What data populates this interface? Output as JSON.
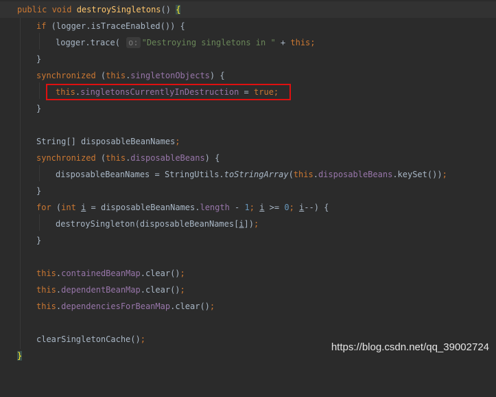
{
  "code": {
    "l1": {
      "mod": "public void ",
      "method": "destroySingletons",
      "rest": "() ",
      "brace": "{"
    },
    "l2": {
      "kw": "if",
      "rest": " (logger.isTraceEnabled()) {"
    },
    "l3": {
      "pre": "logger.trace( ",
      "hint": "o:",
      "str": "\"Destroying singletons in \"",
      "mid": " + ",
      "kw": "this",
      "semi": ";"
    },
    "l4": {
      "text": "}"
    },
    "l5": {
      "kw": "synchronized",
      "p1": " (",
      "kw2": "this",
      "dot": ".",
      "fld": "singletonObjects",
      "p2": ") {"
    },
    "l6": {
      "kw": "this",
      "dot": ".",
      "fld": "singletonsCurrentlyInDestruction",
      "eq": " = ",
      "kw2": "true",
      "semi": ";"
    },
    "l7": {
      "text": "}"
    },
    "l9": {
      "type": "String[] disposableBeanNames",
      "semi": ";"
    },
    "l10": {
      "kw": "synchronized",
      "p1": " (",
      "kw2": "this",
      "dot": ".",
      "fld": "disposableBeans",
      "p2": ") {"
    },
    "l11": {
      "pre": "disposableBeanNames = StringUtils.",
      "it": "toStringArray",
      "p1": "(",
      "kw": "this",
      "dot": ".",
      "fld": "disposableBeans",
      "rest": ".keySet())",
      "semi": ";"
    },
    "l12": {
      "text": "}"
    },
    "l13": {
      "kw": "for",
      "p1": " (",
      "kw2": "int",
      "sp": " ",
      "v1": "i",
      "mid": " = disposableBeanNames.",
      "fld": "length",
      "minus": " - ",
      "n1": "1",
      "s1": "; ",
      "v2": "i",
      "ge": " >= ",
      "n2": "0",
      "s2": "; ",
      "v3": "i",
      "end": "--) {"
    },
    "l14": {
      "pre": "destroySingleton(disposableBeanNames[",
      "v": "i",
      "post": "])",
      "semi": ";"
    },
    "l15": {
      "text": "}"
    },
    "l17": {
      "kw": "this",
      "dot": ".",
      "fld": "containedBeanMap",
      "rest": ".clear()",
      "semi": ";"
    },
    "l18": {
      "kw": "this",
      "dot": ".",
      "fld": "dependentBeanMap",
      "rest": ".clear()",
      "semi": ";"
    },
    "l19": {
      "kw": "this",
      "dot": ".",
      "fld": "dependenciesForBeanMap",
      "rest": ".clear()",
      "semi": ";"
    },
    "l21": {
      "pre": "clearSingletonCache()",
      "semi": ";"
    },
    "l22": {
      "text": "}"
    }
  },
  "watermark": "https://blog.csdn.net/qq_39002724",
  "colors": {
    "background": "#2b2b2b",
    "keyword": "#cc7832",
    "field": "#9876aa",
    "string": "#6a8759",
    "number": "#6897bb",
    "method": "#ffc66d",
    "highlight_box": "#e01010"
  }
}
